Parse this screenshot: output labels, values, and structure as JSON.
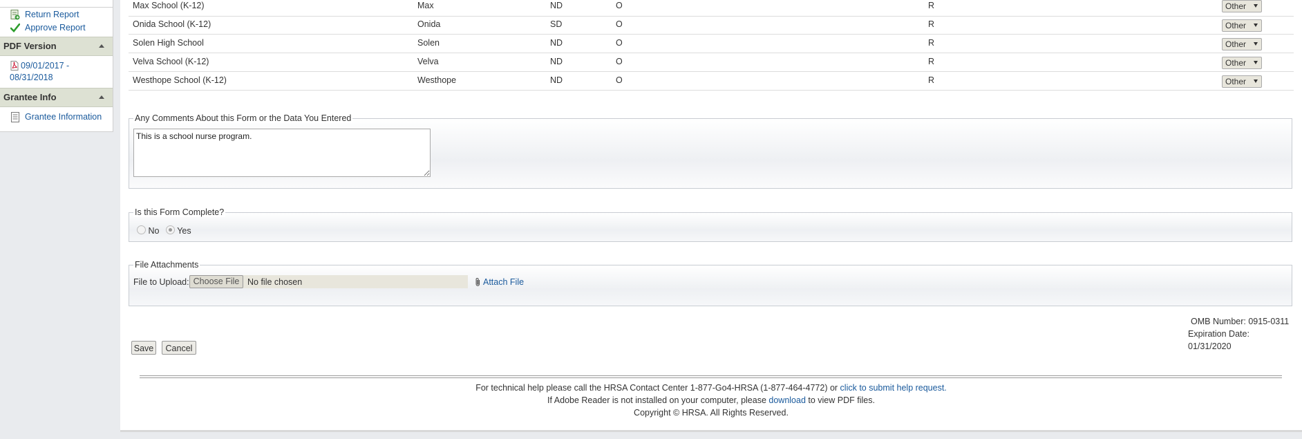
{
  "sidebar": {
    "actions": [
      {
        "label": "Return Report",
        "icon": "return-report-icon"
      },
      {
        "label": "Approve Report",
        "icon": "checkmark-icon"
      }
    ],
    "pdf_header": "PDF Version",
    "pdf_link_line1": "09/01/2017 -",
    "pdf_link_line2": "08/31/2018",
    "grantee_header": "Grantee Info",
    "grantee_link": "Grantee Information"
  },
  "table": {
    "rows": [
      {
        "name": "Max School (K-12)",
        "city": "Max",
        "state": "ND",
        "c4": "O",
        "c5": "R",
        "type": "Other"
      },
      {
        "name": "Onida School (K-12)",
        "city": "Onida",
        "state": "SD",
        "c4": "O",
        "c5": "R",
        "type": "Other"
      },
      {
        "name": "Solen High School",
        "city": "Solen",
        "state": "ND",
        "c4": "O",
        "c5": "R",
        "type": "Other"
      },
      {
        "name": "Velva School (K-12)",
        "city": "Velva",
        "state": "ND",
        "c4": "O",
        "c5": "R",
        "type": "Other"
      },
      {
        "name": "Westhope School (K-12)",
        "city": "Westhope",
        "state": "ND",
        "c4": "O",
        "c5": "R",
        "type": "Other"
      }
    ]
  },
  "comments": {
    "legend": "Any Comments About this Form or the Data You Entered",
    "value": "This is a school nurse program."
  },
  "complete": {
    "legend": "Is this Form Complete?",
    "no_label": "No",
    "yes_label": "Yes",
    "selected": "Yes"
  },
  "attachments": {
    "legend": "File Attachments",
    "upload_label": "File to Upload:",
    "choose_button": "Choose File",
    "no_file_text": "No file chosen",
    "attach_link": "Attach File"
  },
  "omb": {
    "number": "OMB Number: 0915-0311",
    "expiration": "Expiration Date: 01/31/2020"
  },
  "actions": {
    "save": "Save",
    "cancel": "Cancel"
  },
  "footer": {
    "line1_text": "For technical help please call the HRSA Contact Center 1-877-Go4-HRSA (1-877-464-4772) or ",
    "line1_link": "click to submit help request.",
    "line2_pre": "If Adobe Reader is not installed on your computer, please ",
    "line2_link": "download",
    "line2_post": " to view PDF files.",
    "line3": "Copyright © HRSA. All Rights Reserved."
  },
  "colors": {
    "link": "#1a5a9c",
    "sidebar_header_bg": "#dde1d3",
    "page_bg": "#e9ebee"
  }
}
